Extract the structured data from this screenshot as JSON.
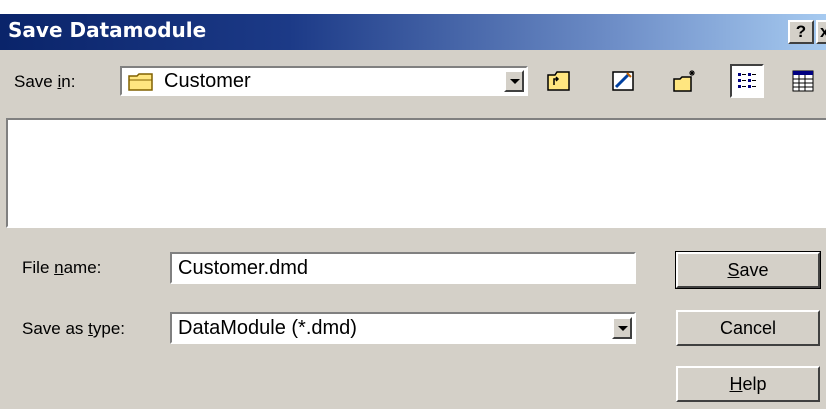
{
  "dialog": {
    "title": "Save Datamodule",
    "help_glyph": "?",
    "close_glyph": "x"
  },
  "save_in": {
    "label_pre": "Save ",
    "label_accel": "i",
    "label_post": "n:",
    "value": "Customer",
    "folder_icon": "folder-icon"
  },
  "toolbar": {
    "icons": [
      "up-one-level-icon",
      "favorites-icon",
      "new-folder-icon",
      "list-view-icon",
      "details-view-icon"
    ]
  },
  "file_name": {
    "label_pre": "File ",
    "label_accel": "n",
    "label_post": "ame:",
    "value": "Customer.dmd"
  },
  "save_as_type": {
    "label_pre": "Save as ",
    "label_accel": "t",
    "label_post": "ype:",
    "value": "DataModule (*.dmd)"
  },
  "buttons": {
    "save_accel": "S",
    "save_rest": "ave",
    "cancel": "Cancel",
    "help_accel": "H",
    "help_rest": "elp"
  },
  "colors": {
    "title_bar": "#0a246a",
    "face": "#d4d0c8"
  }
}
